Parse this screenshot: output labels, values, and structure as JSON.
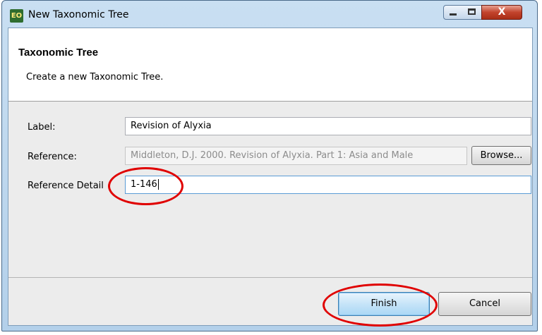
{
  "window": {
    "title": "New Taxonomic Tree",
    "icon_name": "app-icon",
    "icon_text": "EO",
    "controls": {
      "minimize": "minimize-icon",
      "maximize": "maximize-icon",
      "close_glyph": "X"
    }
  },
  "header": {
    "title": "Taxonomic Tree",
    "description": "Create a new Taxonomic Tree."
  },
  "form": {
    "label_label": "Label:",
    "label_value": "Revision of Alyxia",
    "reference_label": "Reference:",
    "reference_value": "Middleton, D.J. 2000. Revision of Alyxia. Part 1: Asia and Male",
    "browse_label": "Browse...",
    "detail_label": "Reference Detail",
    "detail_value": "1-146"
  },
  "footer": {
    "finish_label": "Finish",
    "cancel_label": "Cancel"
  },
  "colors": {
    "annotation": "#e00000",
    "titlebar": "#b9d4ee",
    "close": "#c2432c"
  }
}
